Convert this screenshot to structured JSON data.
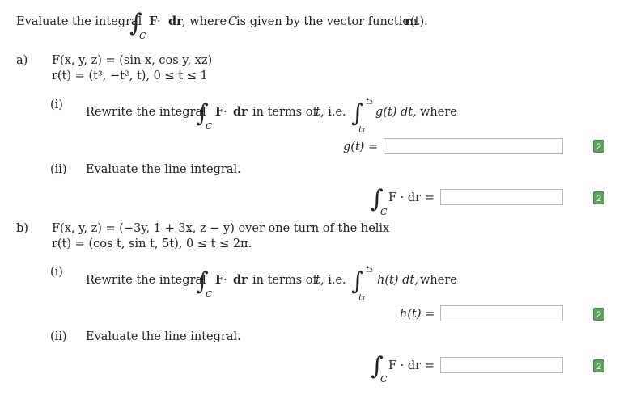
{
  "intro": {
    "before": "Evaluate the integral",
    "F": "F",
    "dot": " · ",
    "dr": "dr",
    "where": ", where",
    "C": "C",
    "rest": " is given by the vector function",
    "r": "r",
    "t_paren": "(t)."
  },
  "parts": {
    "a": {
      "label": "a)",
      "F_line": "F(x, y, z) = (sin x, cos y, xz)",
      "r_line": "r(t) = (t³, −t², t), 0 ≤ t ≤ 1",
      "i": {
        "label": "(i)",
        "rewrite": "Rewrite the integral",
        "in_terms": "in terms of",
        "t": "t",
        "ie": ", i.e.",
        "upper": "t₂",
        "lower": "t₁",
        "integrand": "g(t) dt,",
        "where": "where",
        "answer_label": "g(t) =",
        "answer_value": "",
        "badge": "2"
      },
      "ii": {
        "label": "(ii)",
        "text": "Evaluate the line integral.",
        "answer_label": "F · dr =",
        "answer_value": "",
        "badge": "2"
      }
    },
    "b": {
      "label": "b)",
      "F_line": "F(x, y, z) = (−3y, 1 + 3x, z − y) over one turn of the helix",
      "r_line": "r(t) = (cos t, sin t, 5t), 0 ≤ t ≤ 2π.",
      "i": {
        "label": "(i)",
        "rewrite": "Rewrite the integral",
        "in_terms": "in terms of",
        "t": "t",
        "ie": ", i.e.",
        "upper": "t₂",
        "lower": "t₁",
        "integrand": "h(t) dt,",
        "where": "where",
        "answer_label": "h(t) =",
        "answer_value": "",
        "badge": "2"
      },
      "ii": {
        "label": "(ii)",
        "text": "Evaluate the line integral.",
        "answer_label": "F · dr =",
        "answer_value": "",
        "badge": "2"
      }
    }
  },
  "colors": {
    "badge_bg": "#5aa35a",
    "input_border": "#b9b9b9"
  }
}
